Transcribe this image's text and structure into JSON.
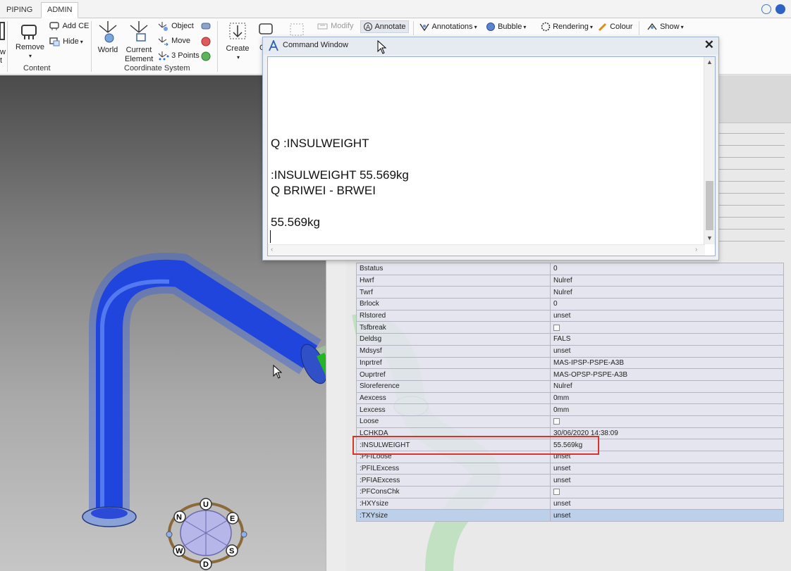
{
  "tabs": [
    {
      "label": "PIPING"
    },
    {
      "label": "ADMIN"
    }
  ],
  "ribbon": {
    "partial_cut": {
      "line1": "w",
      "line2": "t"
    },
    "remove_label": "Remove",
    "add_ce_label": "Add CE",
    "hide_label": "Hide",
    "content_group": "Content",
    "world_label": "World",
    "current_element_line1": "Current",
    "current_element_line2": "Element",
    "object_label": "Object",
    "move_label": "Move",
    "three_points_label": "3 Points",
    "coord_group": "Coordinate System",
    "create_label": "Create",
    "partial_c": "C",
    "modify_label": "Modify",
    "annotate_label": "Annotate",
    "annotations_label": "Annotations",
    "bubble_label": "Bubble",
    "rendering_label": "Rendering",
    "colour_label": "Colour",
    "show_label": "Show"
  },
  "command_window": {
    "title": "Command Window",
    "lines": [
      "Q :INSULWEIGHT",
      "",
      ":INSULWEIGHT 55.569kg",
      "Q BRIWEI - BRWEI",
      "",
      "55.569kg"
    ]
  },
  "compass": {
    "up": "U",
    "down": "D",
    "north": "N",
    "east": "E",
    "south": "S",
    "west": "W"
  },
  "attributes": [
    {
      "name": "Bstatus",
      "value": "0"
    },
    {
      "name": "Hwrf",
      "value": "Nulref"
    },
    {
      "name": "Twrf",
      "value": "Nulref"
    },
    {
      "name": "Brlock",
      "value": "0"
    },
    {
      "name": "Rlstored",
      "value": "unset"
    },
    {
      "name": "Tsfbreak",
      "value": ""
    },
    {
      "name": "Deldsg",
      "value": "FALS"
    },
    {
      "name": "Mdsysf",
      "value": "unset"
    },
    {
      "name": "Inprtref",
      "value": "MAS-IPSP-PSPE-A3B"
    },
    {
      "name": "Ouprtref",
      "value": "MAS-OPSP-PSPE-A3B"
    },
    {
      "name": "Sloreference",
      "value": "Nulref"
    },
    {
      "name": "Aexcess",
      "value": "0mm"
    },
    {
      "name": "Lexcess",
      "value": "0mm"
    },
    {
      "name": "Loose",
      "value": ""
    },
    {
      "name": "LCHKDA",
      "value": "30/06/2020 14:38:09"
    },
    {
      "name": ":INSULWEIGHT",
      "value": "55.569kg"
    },
    {
      "name": ":PFILoose",
      "value": "unset"
    },
    {
      "name": ":PFILExcess",
      "value": "unset"
    },
    {
      "name": ":PFIAExcess",
      "value": "unset"
    },
    {
      "name": ":PFConsChk",
      "value": ""
    },
    {
      "name": ":HXYsize",
      "value": "unset"
    },
    {
      "name": ":TXYsize",
      "value": "unset"
    }
  ],
  "checkbox_rows": [
    5,
    13,
    19
  ],
  "selected_row": 21,
  "highlighted_row": 15,
  "colors": {
    "pipe_blue": "#2a55e6",
    "pipe_green": "#1fbf1f",
    "highlight_red": "#d9342b",
    "selection": "#bcd0ea"
  }
}
